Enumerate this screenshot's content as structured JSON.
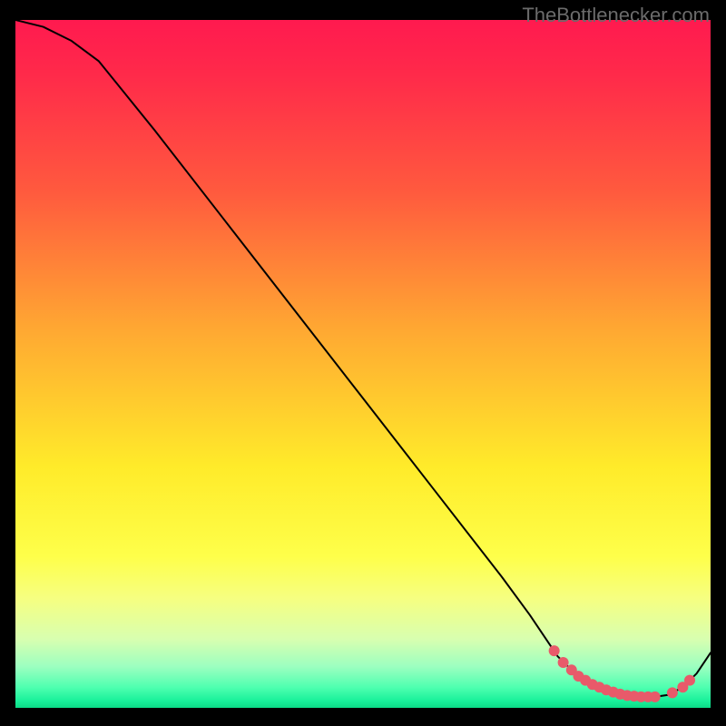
{
  "watermark": "TheBottlenecker.com",
  "chart_data": {
    "type": "line",
    "title": "",
    "xlabel": "",
    "ylabel": "",
    "xlim": [
      0,
      100
    ],
    "ylim": [
      0,
      100
    ],
    "series": [
      {
        "name": "curve",
        "x": [
          0,
          4,
          8,
          12,
          20,
          30,
          40,
          50,
          60,
          70,
          74,
          78,
          80,
          82,
          84,
          86,
          88,
          90,
          92,
          94,
          96,
          98,
          100
        ],
        "values": [
          100,
          99,
          97,
          94,
          84,
          71,
          58,
          45,
          32,
          19,
          13.5,
          7.5,
          5.5,
          4.0,
          3.0,
          2.2,
          1.8,
          1.6,
          1.6,
          1.9,
          3.0,
          5.0,
          8.0
        ]
      }
    ],
    "markers": [
      {
        "x": 77.5,
        "y": 8.3
      },
      {
        "x": 78.8,
        "y": 6.6
      },
      {
        "x": 80.0,
        "y": 5.5
      },
      {
        "x": 81.0,
        "y": 4.6
      },
      {
        "x": 82.0,
        "y": 4.0
      },
      {
        "x": 83.0,
        "y": 3.4
      },
      {
        "x": 84.0,
        "y": 3.0
      },
      {
        "x": 85.0,
        "y": 2.6
      },
      {
        "x": 86.0,
        "y": 2.3
      },
      {
        "x": 87.0,
        "y": 2.0
      },
      {
        "x": 88.0,
        "y": 1.8
      },
      {
        "x": 89.0,
        "y": 1.7
      },
      {
        "x": 90.0,
        "y": 1.6
      },
      {
        "x": 91.0,
        "y": 1.6
      },
      {
        "x": 92.0,
        "y": 1.6
      },
      {
        "x": 94.5,
        "y": 2.2
      },
      {
        "x": 96.0,
        "y": 3.0
      },
      {
        "x": 97.0,
        "y": 4.0
      }
    ]
  }
}
